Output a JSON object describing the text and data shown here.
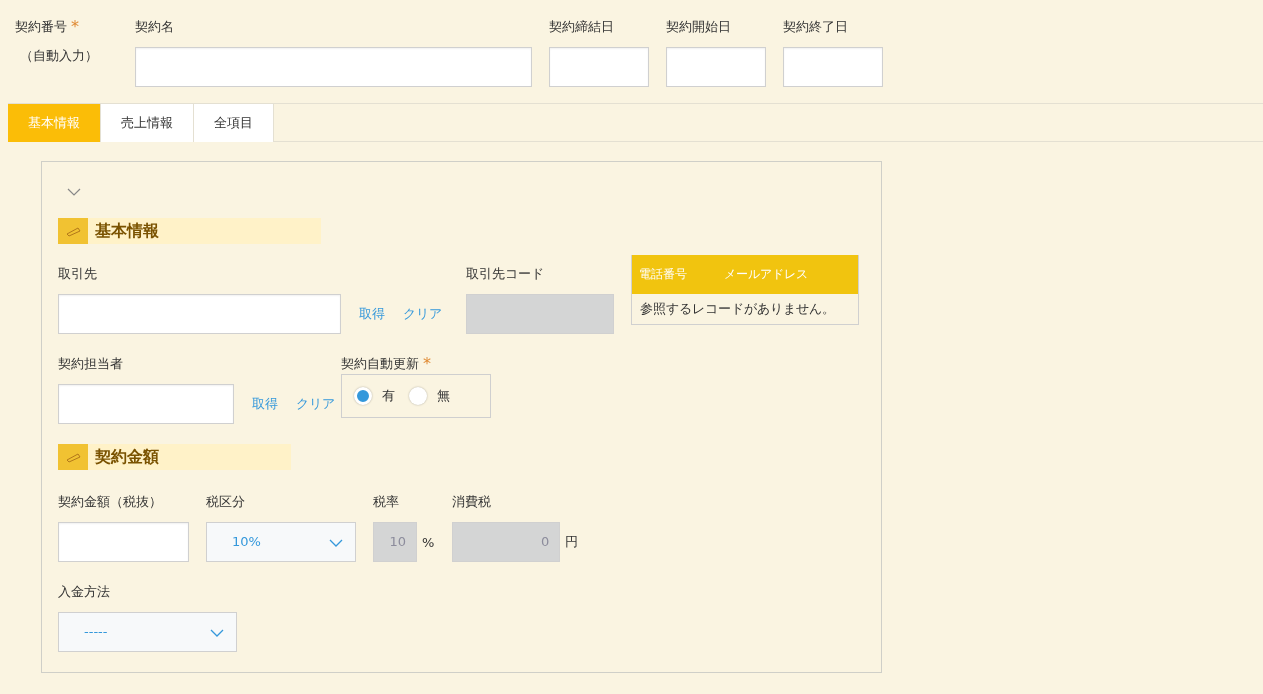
{
  "header": {
    "number": {
      "label": "契約番号",
      "required_mark": "*",
      "note": "（自動入力）"
    },
    "fields": [
      {
        "label": "契約名"
      },
      {
        "label": "契約締結日"
      },
      {
        "label": "契約開始日"
      },
      {
        "label": "契約終了日"
      }
    ]
  },
  "tabs": [
    {
      "label": "基本情報",
      "selected": true
    },
    {
      "label": "売上情報",
      "selected": false
    },
    {
      "label": "全項目",
      "selected": false
    }
  ],
  "section_basic": {
    "title": "基本情報",
    "client": {
      "label": "取引先",
      "actions": [
        "取得",
        "クリア"
      ]
    },
    "client_code": {
      "label": "取引先コード",
      "disabled": true
    },
    "lookup_table": {
      "columns": [
        "電話番号",
        "メールアドレス"
      ],
      "empty_message": "参照するレコードがありません。"
    },
    "owner": {
      "label": "契約担当者",
      "actions": [
        "取得",
        "クリア"
      ]
    },
    "auto_renew": {
      "label": "契約自動更新",
      "required_mark": "*",
      "options": [
        {
          "label": "有",
          "selected": true
        },
        {
          "label": "無",
          "selected": false
        }
      ]
    }
  },
  "section_amount": {
    "title": "契約金額",
    "amount": {
      "label": "契約金額（税抜）"
    },
    "tax_type": {
      "label": "税区分",
      "value": "10%"
    },
    "tax_rate": {
      "label": "税率",
      "value": "10",
      "unit": "%",
      "disabled": true
    },
    "tax": {
      "label": "消費税",
      "value": "0",
      "unit": "円",
      "disabled": true
    },
    "payment": {
      "label": "入金方法",
      "value": "-----"
    }
  }
}
